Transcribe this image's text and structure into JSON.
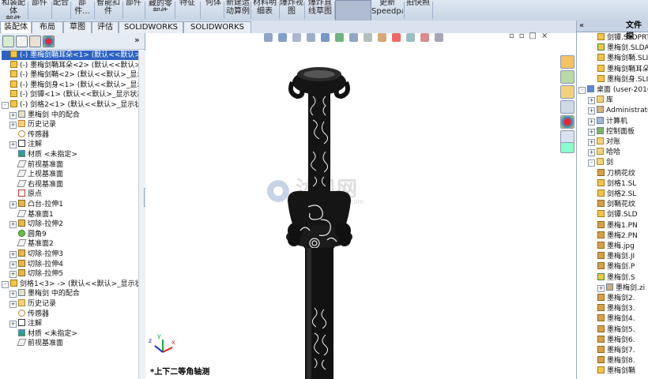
{
  "ribbon": {
    "items": [
      {
        "label": "和装配体\n部件"
      },
      {
        "label": "部件"
      },
      {
        "label": "配合"
      },
      {
        "label": "部件..."
      },
      {
        "label": "智能扣\n件"
      },
      {
        "label": "部件"
      },
      {
        "label": "显示隐\n藏的零\n部件"
      },
      {
        "label": "特征"
      },
      {
        "label": "何体"
      },
      {
        "label": "新建运\n动算例"
      },
      {
        "label": "材料明\n细表"
      },
      {
        "label": "爆炸视\n图"
      },
      {
        "label": "爆炸直\n线草图"
      },
      {
        "label": "Instant3D"
      },
      {
        "label": "更新\nSpeedpak"
      },
      {
        "label": "拍快照"
      }
    ]
  },
  "tabs": [
    "装配体",
    "布局",
    "草图",
    "评估",
    "SOLIDWORKS 插件",
    "SOLIDWORKS MBD"
  ],
  "left_tree": [
    {
      "text": "(-) 墨梅剑鞘耳朵<1> (默认<<默认>_显",
      "indent": 0,
      "hl": true,
      "icon": "part",
      "exp": false
    },
    {
      "text": "(-) 墨梅剑鞘耳朵<2> (默认<<默认>_显",
      "indent": 0,
      "icon": "part"
    },
    {
      "text": "(-) 墨梅剑鞘<2> (默认<<默认>_显示状",
      "indent": 0,
      "icon": "part"
    },
    {
      "text": "(-) 墨梅剑身<1> (默认<<默认>_显示状",
      "indent": 0,
      "icon": "part"
    },
    {
      "text": "(-) 剑镡<1> (默认<<默认>_显示状态 1",
      "indent": 0,
      "icon": "part"
    },
    {
      "text": "(-) 剑格2<1> (默认<<默认>_显示状态",
      "indent": 0,
      "icon": "part",
      "exp": "-"
    },
    {
      "text": "墨梅剑 中的配合",
      "indent": 1,
      "icon": "mate",
      "exp": "+"
    },
    {
      "text": "历史记录",
      "indent": 1,
      "icon": "folder",
      "exp": "+"
    },
    {
      "text": "传感器",
      "indent": 1,
      "icon": "sensor"
    },
    {
      "text": "注解",
      "indent": 1,
      "icon": "annot",
      "exp": "+"
    },
    {
      "text": "材质 <未指定>",
      "indent": 1,
      "icon": "material"
    },
    {
      "text": "前视基准面",
      "indent": 1,
      "icon": "plane"
    },
    {
      "text": "上视基准面",
      "indent": 1,
      "icon": "plane"
    },
    {
      "text": "右视基准面",
      "indent": 1,
      "icon": "plane"
    },
    {
      "text": "原点",
      "indent": 1,
      "icon": "origin"
    },
    {
      "text": "凸台-拉伸1",
      "indent": 1,
      "icon": "feature",
      "exp": "+"
    },
    {
      "text": "基准面1",
      "indent": 1,
      "icon": "plane"
    },
    {
      "text": "切除-拉伸2",
      "indent": 1,
      "icon": "feature",
      "exp": "+"
    },
    {
      "text": "圆角9",
      "indent": 1,
      "icon": "fillet"
    },
    {
      "text": "基准面2",
      "indent": 1,
      "icon": "plane"
    },
    {
      "text": "切除-拉伸3",
      "indent": 1,
      "icon": "feature",
      "exp": "+"
    },
    {
      "text": "切除-拉伸4",
      "indent": 1,
      "icon": "feature",
      "exp": "+"
    },
    {
      "text": "切除-拉伸5",
      "indent": 1,
      "icon": "feature",
      "exp": "+"
    },
    {
      "text": "剑格1<3> -> (默认<<默认>_显示状",
      "indent": 0,
      "icon": "part",
      "exp": "-"
    },
    {
      "text": "墨梅剑 中的配合",
      "indent": 1,
      "icon": "mate",
      "exp": "+"
    },
    {
      "text": "历史记录",
      "indent": 1,
      "icon": "folder",
      "exp": "+"
    },
    {
      "text": "传感器",
      "indent": 1,
      "icon": "sensor"
    },
    {
      "text": "注解",
      "indent": 1,
      "icon": "annot",
      "exp": "+"
    },
    {
      "text": "材质 <未指定>",
      "indent": 1,
      "icon": "material"
    },
    {
      "text": "前视基准面",
      "indent": 1,
      "icon": "plane"
    }
  ],
  "viewport": {
    "view_label": "*上下二等角轴测",
    "watermark": "沐风网",
    "watermark_url": "www.mfcad.com"
  },
  "right_panel": {
    "title": "文件探",
    "items": [
      {
        "text": "剑镡.SLDPRT",
        "indent": 2,
        "icon": "part"
      },
      {
        "text": "墨梅剑.SLDA",
        "indent": 2,
        "icon": "asm"
      },
      {
        "text": "墨梅剑鞘.SLI",
        "indent": 2,
        "icon": "part"
      },
      {
        "text": "墨梅剑鞘耳朵",
        "indent": 2,
        "icon": "part"
      },
      {
        "text": "墨梅剑身.SLI",
        "indent": 2,
        "icon": "part"
      },
      {
        "text": "桌面 (user-2016",
        "indent": 0,
        "icon": "desktop",
        "exp": "-"
      },
      {
        "text": "库",
        "indent": 1,
        "icon": "folder",
        "exp": "+"
      },
      {
        "text": "Administrato",
        "indent": 1,
        "icon": "user",
        "exp": "+"
      },
      {
        "text": "计算机",
        "indent": 1,
        "icon": "pc",
        "exp": "+"
      },
      {
        "text": "控制面板",
        "indent": 1,
        "icon": "cp",
        "exp": "+"
      },
      {
        "text": "对账",
        "indent": 1,
        "icon": "folder",
        "exp": "+"
      },
      {
        "text": "哈哈",
        "indent": 1,
        "icon": "folder",
        "exp": "+"
      },
      {
        "text": "剑",
        "indent": 1,
        "icon": "folder",
        "exp": "-"
      },
      {
        "text": "刀柄花纹",
        "indent": 2,
        "icon": "img"
      },
      {
        "text": "剑格1.SL",
        "indent": 2,
        "icon": "part"
      },
      {
        "text": "剑格2.SL",
        "indent": 2,
        "icon": "part"
      },
      {
        "text": "剑鞘花纹",
        "indent": 2,
        "icon": "img"
      },
      {
        "text": "剑镡.SLD",
        "indent": 2,
        "icon": "part"
      },
      {
        "text": "墨梅1.PN",
        "indent": 2,
        "icon": "img"
      },
      {
        "text": "墨梅2.PN",
        "indent": 2,
        "icon": "img"
      },
      {
        "text": "墨梅.jpg",
        "indent": 2,
        "icon": "img"
      },
      {
        "text": "墨梅剑.JI",
        "indent": 2,
        "icon": "img"
      },
      {
        "text": "墨梅剑.P",
        "indent": 2,
        "icon": "img"
      },
      {
        "text": "墨梅剑.S",
        "indent": 2,
        "icon": "asm"
      },
      {
        "text": "墨梅剑.zi",
        "indent": 2,
        "icon": "zip",
        "exp": "+"
      },
      {
        "text": "墨梅剑2.",
        "indent": 2,
        "icon": "img"
      },
      {
        "text": "墨梅剑3.",
        "indent": 2,
        "icon": "img"
      },
      {
        "text": "墨梅剑4.",
        "indent": 2,
        "icon": "img"
      },
      {
        "text": "墨梅剑5.",
        "indent": 2,
        "icon": "img"
      },
      {
        "text": "墨梅剑6.",
        "indent": 2,
        "icon": "img"
      },
      {
        "text": "墨梅剑7.",
        "indent": 2,
        "icon": "img"
      },
      {
        "text": "墨梅剑8.",
        "indent": 2,
        "icon": "img"
      },
      {
        "text": "墨梅剑鞘",
        "indent": 2,
        "icon": "part"
      }
    ]
  },
  "colors": {
    "selection": "#2c62c2",
    "ribbon": "#d4dde9",
    "sword": "#111111"
  }
}
